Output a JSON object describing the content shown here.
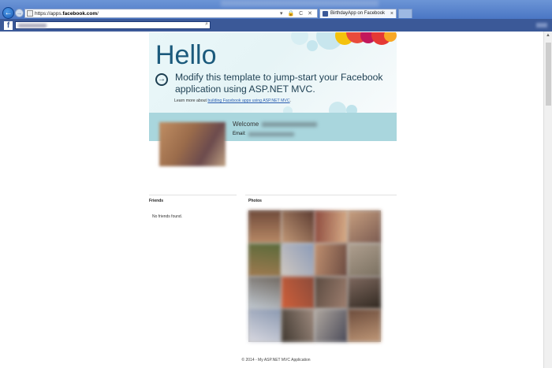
{
  "browser": {
    "url_prefix": "https://apps.",
    "url_domain": "facebook.com",
    "url_suffix": "/",
    "tab_title": "BirthdayApp on Facebook",
    "address_tools": "▾ 🔒 C ✕",
    "tab_close": "×"
  },
  "facebook_bar": {
    "logo": "f"
  },
  "hero": {
    "heading": "Hello",
    "text": "Modify this template to jump-start your Facebook application using ASP.NET MVC.",
    "learn_prefix": "Learn more about ",
    "learn_link": "building Facebook apps using ASP.NET MVC",
    "learn_suffix": "."
  },
  "profile": {
    "welcome_label": "Welcome",
    "email_label": "Email:"
  },
  "friends": {
    "title": "Friends",
    "empty_text": "No friends found."
  },
  "photos": {
    "title": "Photos",
    "count": 16
  },
  "footer": {
    "text": "© 2014 - My ASP.NET MVC Application"
  },
  "colors": {
    "facebook_blue": "#3b5998",
    "hero_heading": "#1b5a7c",
    "band": "#a9d6dd"
  }
}
